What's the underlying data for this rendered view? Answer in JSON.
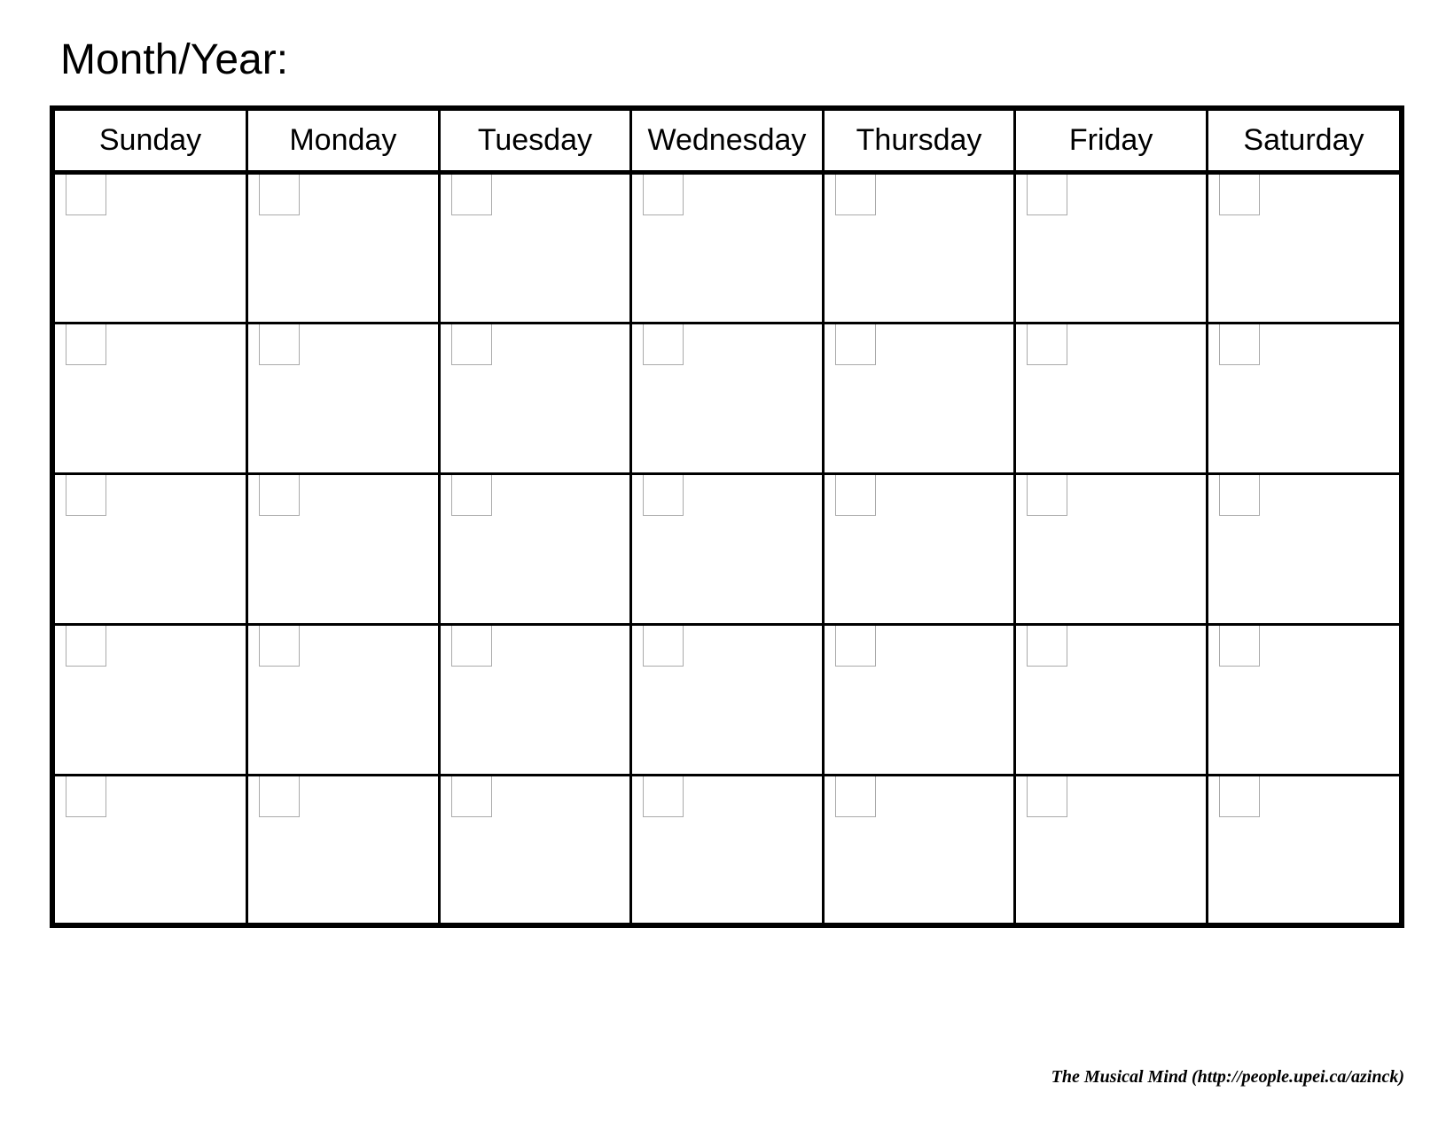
{
  "title": "Month/Year:",
  "days": [
    "Sunday",
    "Monday",
    "Tuesday",
    "Wednesday",
    "Thursday",
    "Friday",
    "Saturday"
  ],
  "weeks": 5,
  "footer": "The Musical Mind   (http://people.upei.ca/azinck)"
}
